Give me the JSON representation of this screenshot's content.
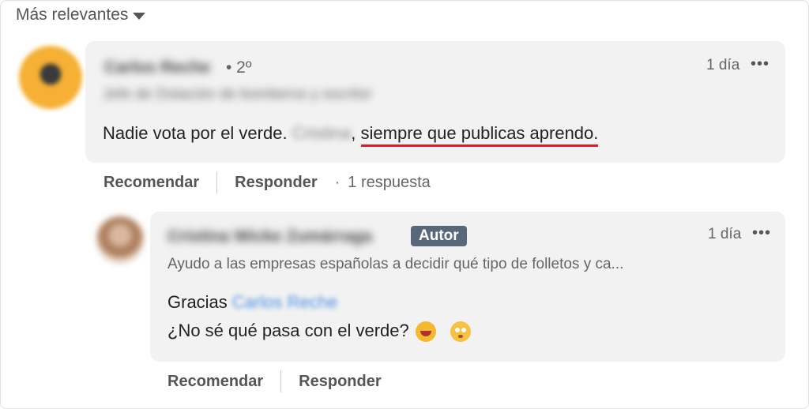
{
  "sort": {
    "label": "Más relevantes"
  },
  "comment1": {
    "author": "Carlos Reche",
    "degree": "• 2º",
    "headline": "Jefe de Dotación de bomberos y escritor",
    "time": "1 día",
    "more": "•••",
    "text_before": "Nadie vota por el verde. ",
    "mention": "Cristina",
    "text_comma": ",",
    "text_underlined": "siempre que publicas aprendo.",
    "actions": {
      "like": "Recomendar",
      "reply": "Responder",
      "dot": "·",
      "replies": "1 respuesta"
    }
  },
  "comment2": {
    "author": "Cristina Wicke Zumárraga",
    "badge": "Autor",
    "headline": "Ayudo a las empresas españolas a decidir qué tipo de folletos y ca...",
    "time": "1 día",
    "more": "•••",
    "line1_before": "Gracias ",
    "mention": "Carlos Reche",
    "line2": "¿No sé qué pasa con el verde?",
    "emojis": [
      "rolling-on-floor-laughing",
      "thinking-face"
    ],
    "actions": {
      "like": "Recomendar",
      "reply": "Responder"
    }
  },
  "colors": {
    "badge": "#56687a",
    "underline": "#e01b22",
    "bubble": "#f2f2f2",
    "mention": "#4a90e2"
  }
}
